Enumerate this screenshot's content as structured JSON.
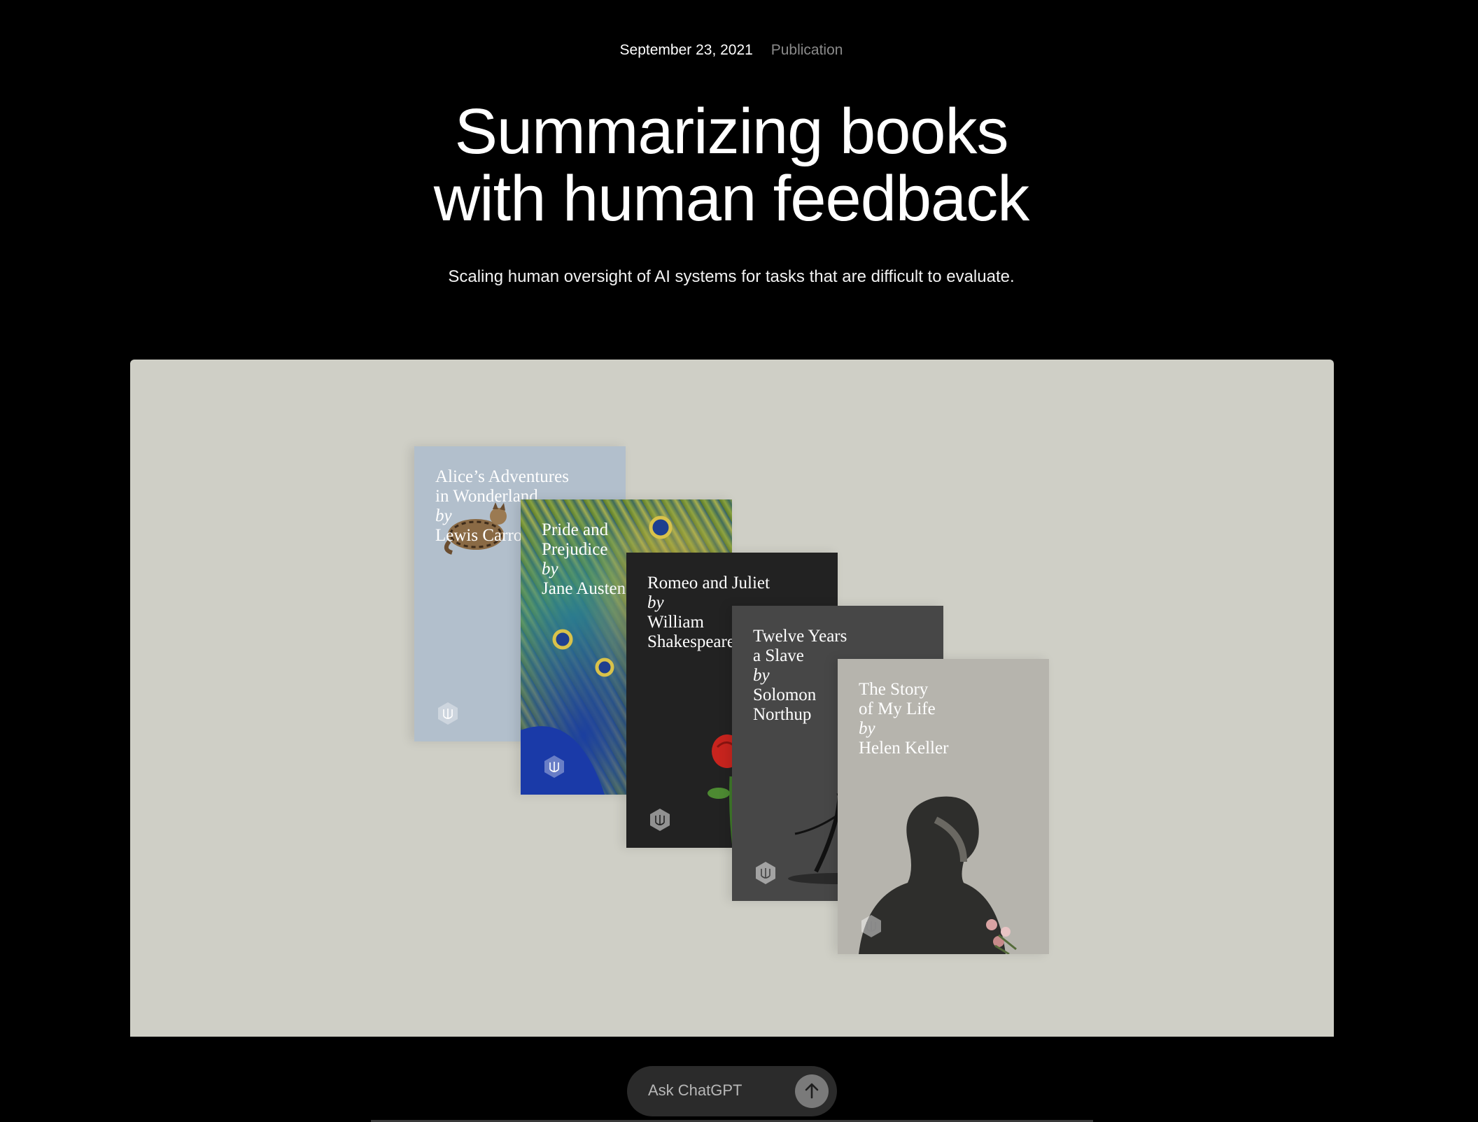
{
  "header": {
    "date": "September 23, 2021",
    "category": "Publication"
  },
  "headline": {
    "line1": "Summarizing books",
    "line2": "with human feedback"
  },
  "subtitle": "Scaling human oversight of AI systems for tasks that are difficult to evaluate.",
  "books": [
    {
      "title_lines": [
        "Alice’s Adventures",
        "in Wonderland"
      ],
      "by": "by",
      "author": "Lewis Carroll",
      "cover_color": "#b2bfcc"
    },
    {
      "title_lines": [
        "Pride and",
        "Prejudice"
      ],
      "by": "by",
      "author": "Jane Austen",
      "cover_color": "#4a6d3a"
    },
    {
      "title_lines": [
        "Romeo and Juliet"
      ],
      "by": "by",
      "author_lines": [
        "William",
        "Shakespeare"
      ],
      "cover_color": "#222222"
    },
    {
      "title_lines": [
        "Twelve Years",
        "a Slave"
      ],
      "by": "by",
      "author_lines": [
        "Solomon",
        "Northup"
      ],
      "cover_color": "#474747"
    },
    {
      "title_lines": [
        "The Story",
        "of My Life"
      ],
      "by": "by",
      "author": "Helen Keller",
      "cover_color": "#b6b4ad"
    }
  ],
  "composer": {
    "placeholder": "Ask ChatGPT",
    "send_icon": "arrow-up-icon"
  },
  "colors": {
    "background": "#000000",
    "hero_background": "#cfcfc6",
    "category_text": "#8a8a8a"
  }
}
